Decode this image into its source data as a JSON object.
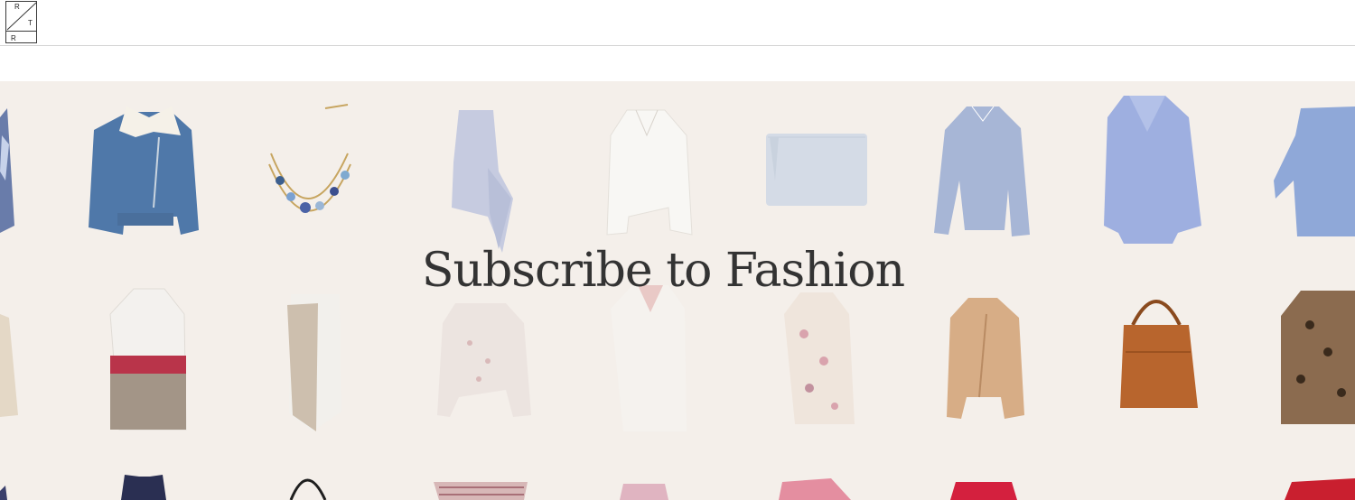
{
  "header": {
    "logo": {
      "letters": [
        "R",
        "T",
        "R"
      ],
      "label": "RTR logo"
    }
  },
  "hero": {
    "headline": "Subscribe to Fashion",
    "background_color": "#f4efea",
    "product_rows": [
      [
        "floral-dress",
        "denim-shearling-jacket",
        "crystal-necklace",
        "ruffle-top",
        "white-blouse",
        "blue-clutch",
        "striped-shirt",
        "blue-coat",
        "bell-sleeve-dress"
      ],
      [
        "lace-top",
        "colorblock-coat",
        "shift-dress",
        "knit-sweater",
        "white-trench",
        "floral-lace-dress",
        "tan-moto-jacket",
        "leather-hobo-bag",
        "leopard-coat"
      ],
      [
        "dress-partial",
        "navy-dress",
        "black-bag",
        "striped-top",
        "pink-skirt",
        "pink-top",
        "red-dress",
        "red-coat"
      ]
    ]
  }
}
